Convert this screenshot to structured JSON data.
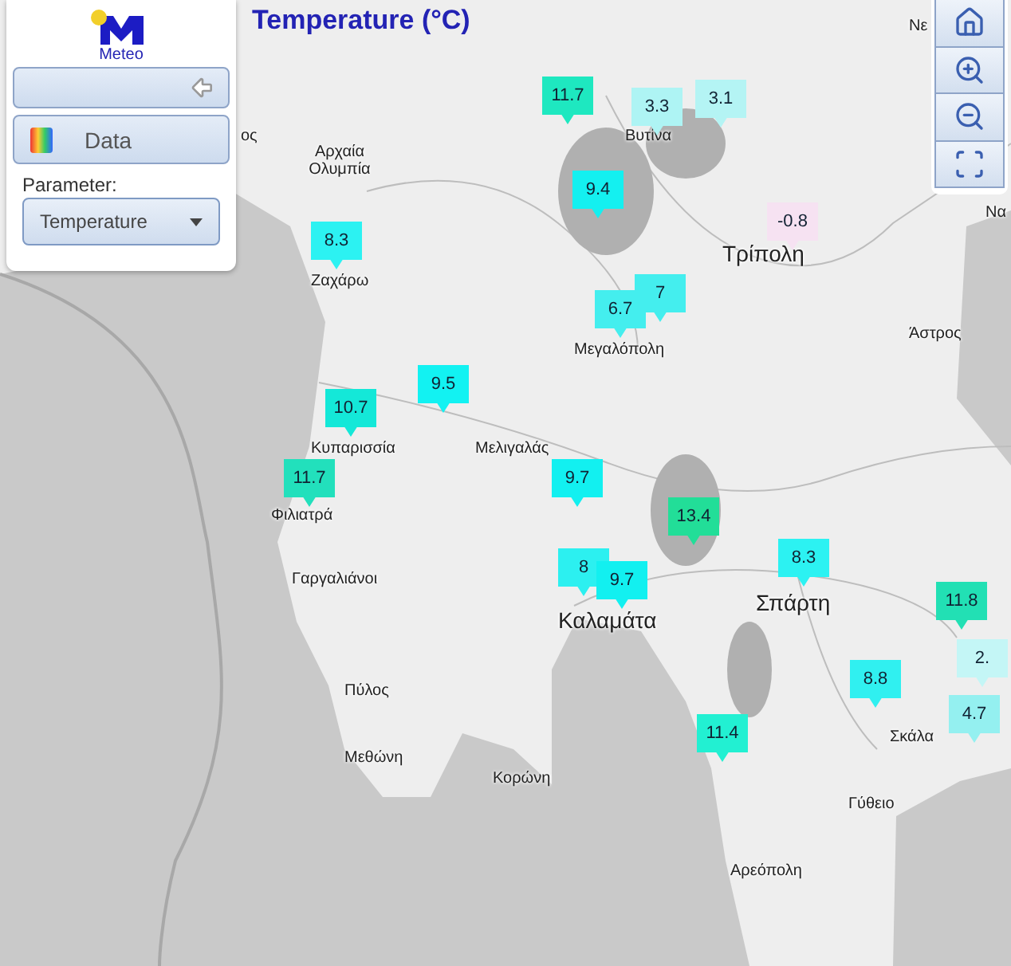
{
  "title": "Temperature (°C)",
  "logo": {
    "text": "Meteo"
  },
  "sidebar": {
    "data_button": "Data",
    "parameter_label": "Parameter:",
    "parameter_select": {
      "value": "Temperature"
    }
  },
  "places": [
    {
      "name": "ος",
      "kind": "town"
    },
    {
      "name": "Αρχαία Ολυμπία",
      "kind": "town"
    },
    {
      "name": "Ζαχάρω",
      "kind": "town"
    },
    {
      "name": "Βυτίνα",
      "kind": "town"
    },
    {
      "name": "Τρίπολη",
      "kind": "city"
    },
    {
      "name": "Μεγαλόπολη",
      "kind": "town"
    },
    {
      "name": "Άστρος",
      "kind": "town"
    },
    {
      "name": "Κυπαρισσία",
      "kind": "town"
    },
    {
      "name": "Μελιγαλάς",
      "kind": "town"
    },
    {
      "name": "Φιλιατρά",
      "kind": "town"
    },
    {
      "name": "Γαργαλιάνοι",
      "kind": "town"
    },
    {
      "name": "Καλαμάτα",
      "kind": "city"
    },
    {
      "name": "Σπάρτη",
      "kind": "city"
    },
    {
      "name": "Πύλος",
      "kind": "town"
    },
    {
      "name": "Μεθώνη",
      "kind": "town"
    },
    {
      "name": "Κορώνη",
      "kind": "town"
    },
    {
      "name": "Σκάλα",
      "kind": "town"
    },
    {
      "name": "Γύθειο",
      "kind": "town"
    },
    {
      "name": "Αρεόπολη",
      "kind": "town"
    },
    {
      "name": "Νε",
      "kind": "town"
    },
    {
      "name": "Να",
      "kind": "town"
    }
  ],
  "markers": [
    {
      "value": "11.7",
      "color": "#1ee8c0"
    },
    {
      "value": "3.3",
      "color": "#aef4f4"
    },
    {
      "value": "3.1",
      "color": "#b4f4f4"
    },
    {
      "value": "9.4",
      "color": "#14f0f0"
    },
    {
      "value": "-0.8",
      "color": "#f6e2f2"
    },
    {
      "value": "8.3",
      "color": "#2cf2f2"
    },
    {
      "value": "7",
      "color": "#44eeee"
    },
    {
      "value": "6.7",
      "color": "#44eeee"
    },
    {
      "value": "9.5",
      "color": "#12f2f2"
    },
    {
      "value": "10.7",
      "color": "#14e8d8"
    },
    {
      "value": "11.7",
      "color": "#22e0bc"
    },
    {
      "value": "9.7",
      "color": "#12f0f0"
    },
    {
      "value": "13.4",
      "color": "#22de98"
    },
    {
      "value": "8",
      "color": "#2cf0f0"
    },
    {
      "value": "9.7",
      "color": "#12f0f0"
    },
    {
      "value": "8.3",
      "color": "#2cf2f2"
    },
    {
      "value": "11.8",
      "color": "#22e0b4"
    },
    {
      "value": "8.8",
      "color": "#30f0f0"
    },
    {
      "value": "2.",
      "color": "#c4f6f6"
    },
    {
      "value": "4.7",
      "color": "#94f0f0"
    },
    {
      "value": "11.4",
      "color": "#22f0d2"
    }
  ]
}
